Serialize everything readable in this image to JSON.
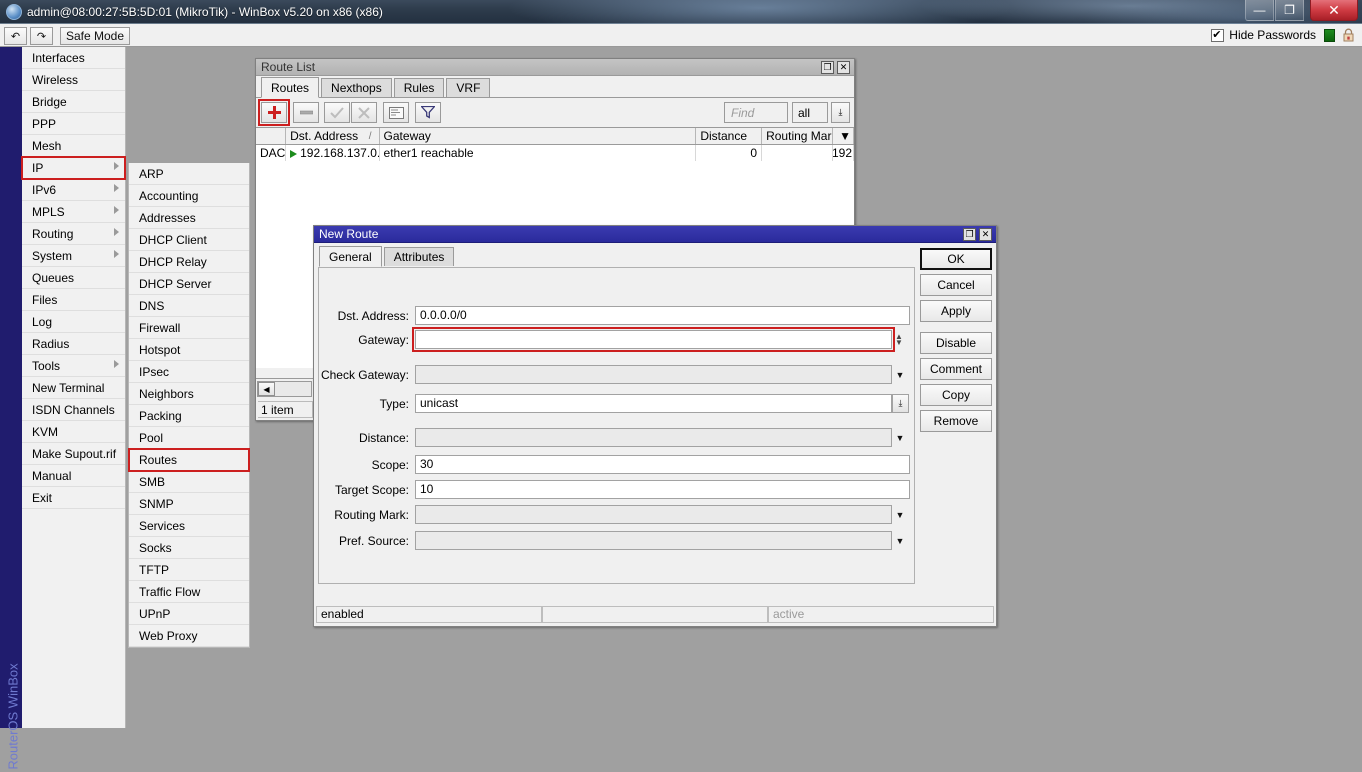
{
  "os_window": {
    "title": "admin@08:00:27:5B:5D:01 (MikroTik) - WinBox v5.20 on x86 (x86)",
    "minimize_label": "—",
    "maximize_label": "❐",
    "close_label": "✕"
  },
  "toolbar": {
    "undo_label": "↶",
    "redo_label": "↷",
    "safe_mode_label": "Safe Mode",
    "hide_passwords_label": "Hide Passwords",
    "hide_passwords_checked": true
  },
  "sidebar": {
    "vertical_label": "RouterOS WinBox",
    "items": [
      {
        "label": "Interfaces",
        "has_submenu": false,
        "selected": false
      },
      {
        "label": "Wireless",
        "has_submenu": false,
        "selected": false
      },
      {
        "label": "Bridge",
        "has_submenu": false,
        "selected": false
      },
      {
        "label": "PPP",
        "has_submenu": false,
        "selected": false
      },
      {
        "label": "Mesh",
        "has_submenu": false,
        "selected": false
      },
      {
        "label": "IP",
        "has_submenu": true,
        "selected": true
      },
      {
        "label": "IPv6",
        "has_submenu": true,
        "selected": false
      },
      {
        "label": "MPLS",
        "has_submenu": true,
        "selected": false
      },
      {
        "label": "Routing",
        "has_submenu": true,
        "selected": false
      },
      {
        "label": "System",
        "has_submenu": true,
        "selected": false
      },
      {
        "label": "Queues",
        "has_submenu": false,
        "selected": false
      },
      {
        "label": "Files",
        "has_submenu": false,
        "selected": false
      },
      {
        "label": "Log",
        "has_submenu": false,
        "selected": false
      },
      {
        "label": "Radius",
        "has_submenu": false,
        "selected": false
      },
      {
        "label": "Tools",
        "has_submenu": true,
        "selected": false
      },
      {
        "label": "New Terminal",
        "has_submenu": false,
        "selected": false
      },
      {
        "label": "ISDN Channels",
        "has_submenu": false,
        "selected": false
      },
      {
        "label": "KVM",
        "has_submenu": false,
        "selected": false
      },
      {
        "label": "Make Supout.rif",
        "has_submenu": false,
        "selected": false
      },
      {
        "label": "Manual",
        "has_submenu": false,
        "selected": false
      },
      {
        "label": "Exit",
        "has_submenu": false,
        "selected": false
      }
    ]
  },
  "ip_submenu": {
    "items": [
      {
        "label": "ARP",
        "selected": false
      },
      {
        "label": "Accounting",
        "selected": false
      },
      {
        "label": "Addresses",
        "selected": false
      },
      {
        "label": "DHCP Client",
        "selected": false
      },
      {
        "label": "DHCP Relay",
        "selected": false
      },
      {
        "label": "DHCP Server",
        "selected": false
      },
      {
        "label": "DNS",
        "selected": false
      },
      {
        "label": "Firewall",
        "selected": false
      },
      {
        "label": "Hotspot",
        "selected": false
      },
      {
        "label": "IPsec",
        "selected": false
      },
      {
        "label": "Neighbors",
        "selected": false
      },
      {
        "label": "Packing",
        "selected": false
      },
      {
        "label": "Pool",
        "selected": false
      },
      {
        "label": "Routes",
        "selected": true
      },
      {
        "label": "SMB",
        "selected": false
      },
      {
        "label": "SNMP",
        "selected": false
      },
      {
        "label": "Services",
        "selected": false
      },
      {
        "label": "Socks",
        "selected": false
      },
      {
        "label": "TFTP",
        "selected": false
      },
      {
        "label": "Traffic Flow",
        "selected": false
      },
      {
        "label": "UPnP",
        "selected": false
      },
      {
        "label": "Web Proxy",
        "selected": false
      }
    ]
  },
  "route_list": {
    "title": "Route List",
    "maximize_label": "❐",
    "close_label": "✕",
    "tabs": [
      {
        "label": "Routes",
        "active": true
      },
      {
        "label": "Nexthops",
        "active": false
      },
      {
        "label": "Rules",
        "active": false
      },
      {
        "label": "VRF",
        "active": false
      }
    ],
    "toolbar": {
      "add_label": "＋",
      "remove_label": "—",
      "enable_label": "✓",
      "disable_label": "✗",
      "comment_label": "▤",
      "filter_label": "▽",
      "find_placeholder": "Find",
      "find_value": "",
      "scope_value": "all",
      "scope_drop_label": "⤓"
    },
    "table": {
      "columns": [
        "",
        "Dst. Address",
        "Gateway",
        "Distance",
        "Routing Mark",
        ""
      ],
      "sort_indicator": "/",
      "more_label": "▼",
      "rows": [
        {
          "flags": "DAC",
          "dst_address": "192.168.137.0...",
          "gateway": "ether1 reachable",
          "distance": "0",
          "routing_mark": "",
          "overflow": "192"
        }
      ]
    },
    "status": {
      "item_count": "1 item",
      "scroll_left_label": "◀"
    }
  },
  "new_route": {
    "title": "New Route",
    "maximize_label": "❐",
    "close_label": "✕",
    "tabs": [
      {
        "label": "General",
        "active": true
      },
      {
        "label": "Attributes",
        "active": false
      }
    ],
    "fields": [
      {
        "label": "Dst. Address:",
        "value": "0.0.0.0/0",
        "control": "text",
        "disabled": false,
        "highlight": false
      },
      {
        "label": "Gateway:",
        "value": "",
        "control": "spinner",
        "disabled": false,
        "highlight": true
      },
      {
        "label": "Check Gateway:",
        "value": "",
        "control": "dropdown-flat",
        "disabled": true,
        "highlight": false
      },
      {
        "label": "Type:",
        "value": "unicast",
        "control": "dropdown-button",
        "disabled": false,
        "highlight": false
      },
      {
        "label": "Distance:",
        "value": "",
        "control": "dropdown-flat",
        "disabled": true,
        "highlight": false
      },
      {
        "label": "Scope:",
        "value": "30",
        "control": "text",
        "disabled": false,
        "highlight": false
      },
      {
        "label": "Target Scope:",
        "value": "10",
        "control": "text",
        "disabled": false,
        "highlight": false
      },
      {
        "label": "Routing Mark:",
        "value": "",
        "control": "dropdown-flat",
        "disabled": true,
        "highlight": false
      },
      {
        "label": "Pref. Source:",
        "value": "",
        "control": "dropdown-flat",
        "disabled": true,
        "highlight": false
      }
    ],
    "buttons": [
      {
        "label": "OK",
        "primary": true
      },
      {
        "label": "Cancel",
        "primary": false
      },
      {
        "label": "Apply",
        "primary": false
      },
      {
        "label": "Disable",
        "primary": false
      },
      {
        "label": "Comment",
        "primary": false
      },
      {
        "label": "Copy",
        "primary": false
      },
      {
        "label": "Remove",
        "primary": false
      }
    ],
    "status": {
      "left": "enabled",
      "middle": "",
      "right": "active"
    }
  },
  "colors": {
    "highlight_red": "#cc1f1f",
    "active_title": "#2a2a9c",
    "sidebar_blue": "#201c6e",
    "workspace_gray": "#a0a0a0"
  }
}
